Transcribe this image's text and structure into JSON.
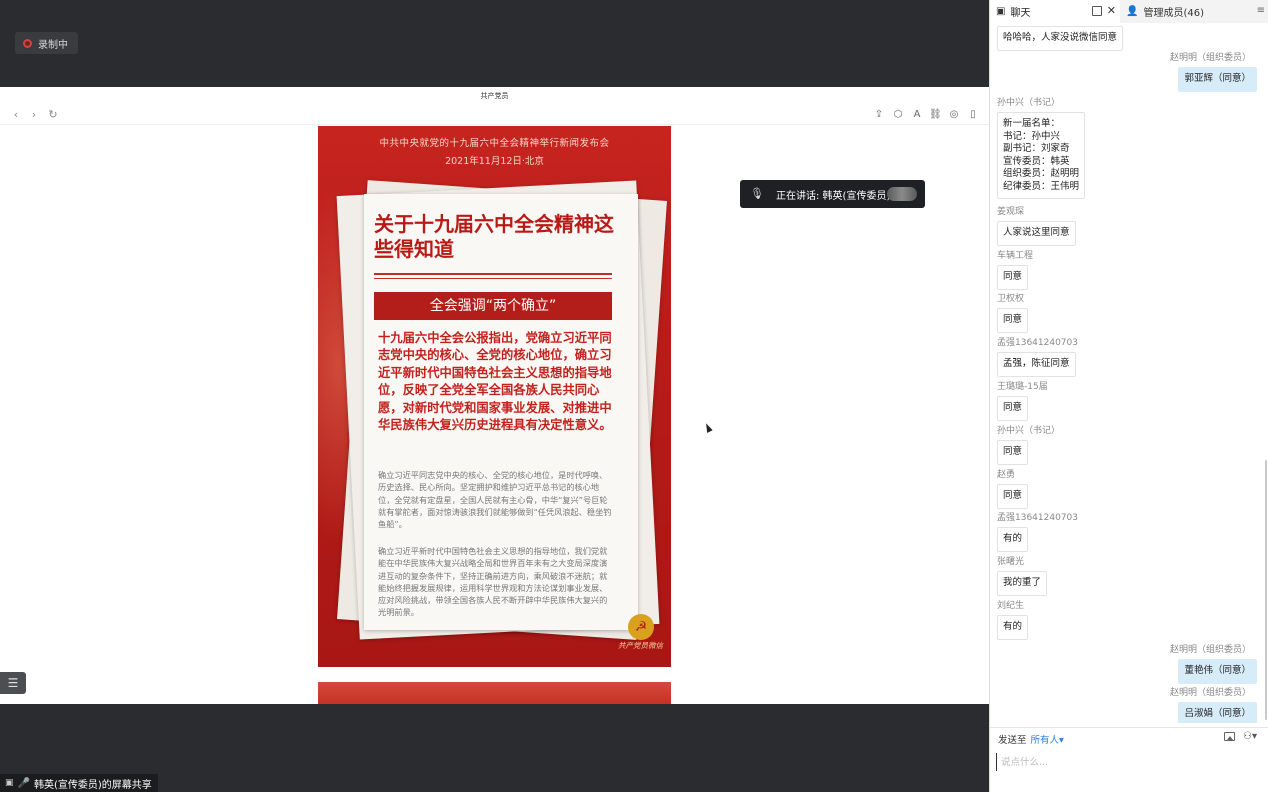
{
  "recording": {
    "label": "录制中"
  },
  "share": {
    "window_title": "共产党员",
    "presenter_label": "韩英(宣传委员)的屏幕共享",
    "speaking": "正在讲话: 韩英(宣传委员);"
  },
  "poster": {
    "header_line1": "中共中央就党的十九届六中全会精神举行新闻发布会",
    "header_line2": "2021年11月12日·北京",
    "main_title": "关于十九届六中全会精神这些得知道",
    "banner": "全会强调“两个确立”",
    "lead": "十九届六中全会公报指出，党确立习近平同志党中央的核心、全党的核心地位，确立习近平新时代中国特色社会主义思想的指导地位，反映了全党全军全国各族人民共同心愿，对新时代党和国家事业发展、对推进中华民族伟大复兴历史进程具有决定性意义。",
    "para1": "确立习近平同志党中央的核心、全党的核心地位，是时代呼唤、历史选择、民心所向。坚定拥护和维护习近平总书记的核心地位，全党就有定盘星，全国人民就有主心骨，中华“复兴”号巨轮就有掌舵者，面对惊涛骇浪我们就能够做到“任凭风浪起、稳坐钓鱼船”。",
    "para2": "确立习近平新时代中国特色社会主义思想的指导地位，我们党就能在中华民族伟大复兴战略全局和世界百年未有之大变局深度演进互动的复杂条件下，坚持正确前进方向，乘风破浪不迷航；就能始终把握发展规律，运用科学世界观和方法论谋划事业发展、应对风险挑战，带领全国各族人民不断开辟中华民族伟大复兴的光明前景。",
    "signature": "共产党员微信"
  },
  "panel": {
    "tab_chat": "聊天",
    "tab_members": "管理成员(46)"
  },
  "messages": [
    {
      "side": "left",
      "name": "",
      "text": "哈哈哈，人家没说微信同意"
    },
    {
      "side": "right",
      "name": "赵明明（组织委员）",
      "text": "郭亚辉（同意）"
    },
    {
      "side": "left",
      "name": "孙中兴（书记）",
      "text": "新一届名单：\n书记：孙中兴\n副书记：刘家奇\n宣传委员：韩英\n组织委员：赵明明\n纪律委员：王伟明"
    },
    {
      "side": "left",
      "name": "姜观琛",
      "text": "人家说这里同意"
    },
    {
      "side": "left",
      "name": "车辆工程",
      "text": "同意"
    },
    {
      "side": "left",
      "name": "卫权权",
      "text": "同意"
    },
    {
      "side": "left",
      "name": "孟强13641240703",
      "text": "孟强，陈征同意"
    },
    {
      "side": "left",
      "name": "王璐璐-15届",
      "text": "同意"
    },
    {
      "side": "left",
      "name": "孙中兴（书记）",
      "text": "同意"
    },
    {
      "side": "left",
      "name": "赵勇",
      "text": "同意"
    },
    {
      "side": "left",
      "name": "孟强13641240703",
      "text": "有的"
    },
    {
      "side": "left",
      "name": "张曙光",
      "text": "我的重了"
    },
    {
      "side": "left",
      "name": "刘纪生",
      "text": "有的"
    },
    {
      "side": "right",
      "name": "赵明明（组织委员）",
      "text": "董艳伟（同意）"
    },
    {
      "side": "right",
      "name": "赵明明（组织委员）",
      "text": "吕淑娟（同意）"
    }
  ],
  "compose": {
    "send_to_label": "发送至",
    "send_target": "所有人▾",
    "placeholder": "说点什么..."
  },
  "colors": {
    "accent": "#2a7de1",
    "poster_red": "#b41e1a",
    "mine_bubble": "#d7ecf9"
  }
}
